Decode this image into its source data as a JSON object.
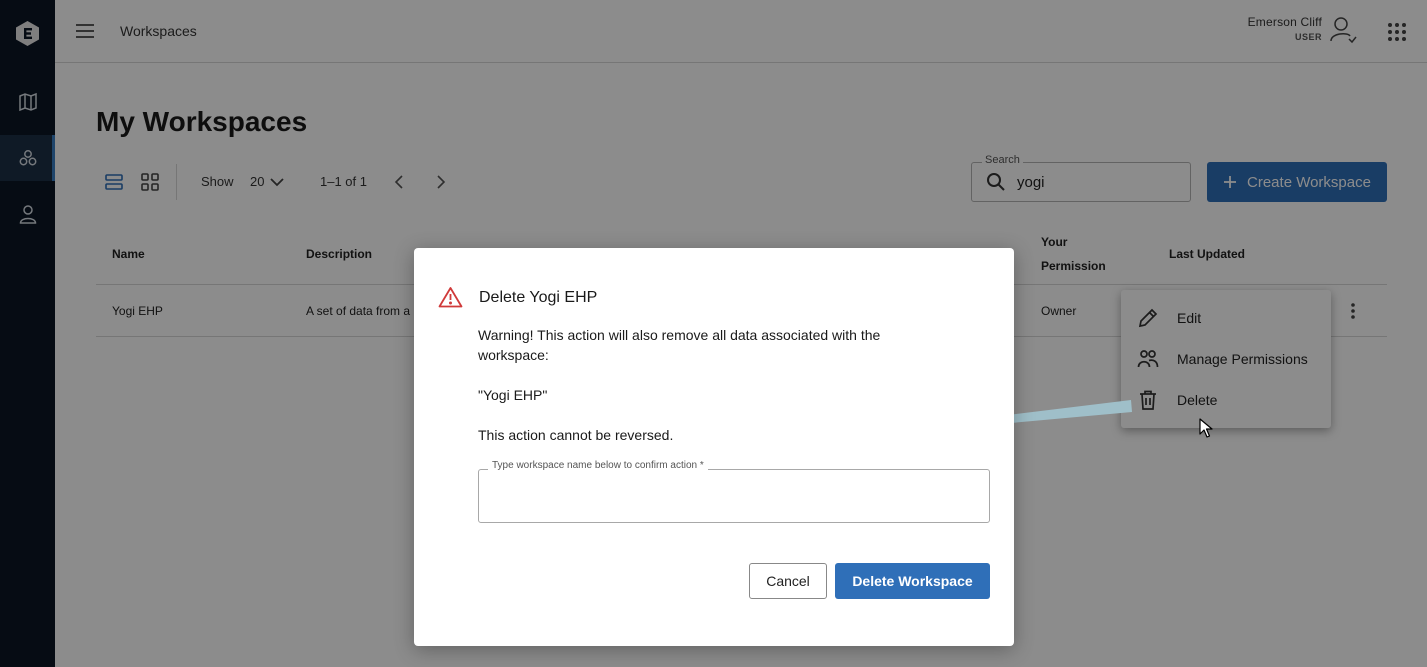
{
  "topbar": {
    "breadcrumb": "Workspaces",
    "user_name": "Emerson Cliff",
    "user_role": "USER"
  },
  "page": {
    "title": "My Workspaces"
  },
  "toolbar": {
    "show_label": "Show",
    "page_size": "20",
    "range": "1–1 of 1",
    "search_label": "Search",
    "search_value": "yogi",
    "create_label": "Create Workspace"
  },
  "table": {
    "headers": {
      "name": "Name",
      "description": "Description",
      "permission_line1": "Your",
      "permission_line2": "Permission",
      "updated": "Last Updated"
    },
    "rows": [
      {
        "name": "Yogi EHP",
        "description": "A set of data from a",
        "permission": "Owner"
      }
    ]
  },
  "context_menu": {
    "edit": "Edit",
    "manage": "Manage Permissions",
    "delete": "Delete"
  },
  "modal": {
    "title": "Delete Yogi EHP",
    "warning_line1": "Warning! This action will also remove all data associated with the",
    "warning_line2": "workspace:",
    "workspace_name": "\"Yogi EHP\"",
    "irreversible": "This action cannot be reversed.",
    "field_label": "Type workspace name below to confirm action *",
    "field_value": "",
    "cancel_label": "Cancel",
    "delete_label": "Delete Workspace"
  },
  "colors": {
    "sidebar": "#0b1725",
    "primary": "#2f6fb8",
    "warning": "#d03a3a",
    "arrow": "#9fbfc9"
  },
  "icons": {
    "logo": "app-logo-icon",
    "map": "map-icon",
    "workspaces": "workspaces-icon",
    "profile": "person-icon",
    "menu": "hamburger-icon",
    "user": "user-account-icon",
    "apps": "apps-grid-icon"
  }
}
